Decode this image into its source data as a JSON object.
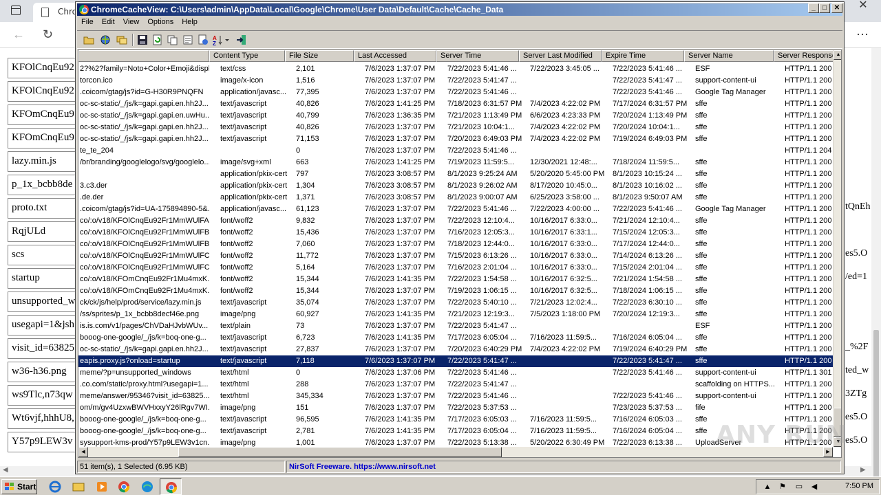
{
  "background": {
    "tab_title": "Chro",
    "left_list": [
      "KFOlCnqEu92",
      "KFOlCnqEu92",
      "KFOmCnqEu9",
      "KFOmCnqEu9",
      "lazy.min.js",
      "p_1x_bcbb8de",
      "proto.txt",
      "RqjULd",
      "scs",
      "startup",
      "unsupported_w",
      "usegapi=1&jsh",
      "visit_id=63825",
      "w36-h36.png",
      "ws9Tlc,n73qw",
      "Wt6vjf,hhhU8,",
      "Y57p9LEW3v"
    ],
    "right_list": [
      "tQnEh",
      "",
      "es5.O",
      "/ed=1",
      "",
      "",
      "_%2F",
      "ted_w",
      "3ZTg",
      "es5.O",
      "es5.O"
    ]
  },
  "app": {
    "title": "ChromeCacheView:  C:\\Users\\admin\\AppData\\Local\\Google\\Chrome\\User Data\\Default\\Cache\\Cache_Data",
    "menu": [
      "File",
      "Edit",
      "View",
      "Options",
      "Help"
    ],
    "columns": [
      "",
      "Content Type",
      "File Size",
      "Last Accessed",
      "Server Time",
      "Server Last Modified",
      "Expire Time",
      "Server Name",
      "Server Response"
    ],
    "rows": [
      [
        "2?%2?family=Noto+Color+Emoji&displ...",
        "text/css",
        "2,101",
        "7/6/2023 1:37:07 PM",
        "7/22/2023 5:41:46 ...",
        "7/22/2023 3:45:05 ...",
        "7/22/2023 5:41:46 ...",
        "ESF",
        "HTTP/1.1 200"
      ],
      [
        "torcon.ico",
        "image/x-icon",
        "1,516",
        "7/6/2023 1:37:07 PM",
        "7/22/2023 5:41:47 ...",
        "",
        "7/22/2023 5:41:47 ...",
        "support-content-ui",
        "HTTP/1.1 200"
      ],
      [
        ".coicom/gtag/js?id=G-H30R9PNQFN",
        "application/javasc...",
        "77,395",
        "7/6/2023 1:37:07 PM",
        "7/22/2023 5:41:46 ...",
        "",
        "7/22/2023 5:41:46 ...",
        "Google Tag Manager",
        "HTTP/1.1 200"
      ],
      [
        "oc-sc-static/_/js/k=gapi.gapi.en.hh2J...",
        "text/javascript",
        "40,826",
        "7/6/2023 1:41:25 PM",
        "7/18/2023 6:31:57 PM",
        "7/4/2023 4:22:02 PM",
        "7/17/2024 6:31:57 PM",
        "sffe",
        "HTTP/1.1 200"
      ],
      [
        "oc-sc-static/_/js/k=gapi.gapi.en.uwHu...",
        "text/javascript",
        "40,799",
        "7/6/2023 1:36:35 PM",
        "7/21/2023 1:13:49 PM",
        "6/6/2023 4:23:33 PM",
        "7/20/2024 1:13:49 PM",
        "sffe",
        "HTTP/1.1 200"
      ],
      [
        "oc-sc-static/_/js/k=gapi.gapi.en.hh2J...",
        "text/javascript",
        "40,826",
        "7/6/2023 1:37:07 PM",
        "7/21/2023 10:04:1...",
        "7/4/2023 4:22:02 PM",
        "7/20/2024 10:04:1...",
        "sffe",
        "HTTP/1.1 200"
      ],
      [
        "oc-sc-static/_/js/k=gapi.gapi.en.hh2J...",
        "text/javascript",
        "71,153",
        "7/6/2023 1:37:07 PM",
        "7/20/2023 6:49:03 PM",
        "7/4/2023 4:22:02 PM",
        "7/19/2024 6:49:03 PM",
        "sffe",
        "HTTP/1.1 200"
      ],
      [
        "te_te_204",
        "",
        "0",
        "7/6/2023 1:37:07 PM",
        "7/22/2023 5:41:46 ...",
        "",
        "",
        "",
        "HTTP/1.1 204"
      ],
      [
        "/br/branding/googlelogo/svg/googlelo...",
        "image/svg+xml",
        "663",
        "7/6/2023 1:41:25 PM",
        "7/19/2023 11:59:5...",
        "12/30/2021 12:48:...",
        "7/18/2024 11:59:5...",
        "sffe",
        "HTTP/1.1 200"
      ],
      [
        "",
        "application/pkix-cert",
        "797",
        "7/6/2023 3:08:57 PM",
        "8/1/2023 9:25:24 AM",
        "5/20/2020 5:45:00 PM",
        "8/1/2023 10:15:24 ...",
        "sffe",
        "HTTP/1.1 200"
      ],
      [
        "3.c3.der",
        "application/pkix-cert",
        "1,304",
        "7/6/2023 3:08:57 PM",
        "8/1/2023 9:26:02 AM",
        "8/17/2020 10:45:0...",
        "8/1/2023 10:16:02 ...",
        "sffe",
        "HTTP/1.1 200"
      ],
      [
        ".de.der",
        "application/pkix-cert",
        "1,371",
        "7/6/2023 3:08:57 PM",
        "8/1/2023 9:00:07 AM",
        "6/25/2023 3:58:00 ...",
        "8/1/2023 9:50:07 AM",
        "sffe",
        "HTTP/1.1 200"
      ],
      [
        ".coicom/gtag/js?id=UA-175894890-5&...",
        "application/javasc...",
        "61,123",
        "7/6/2023 1:37:07 PM",
        "7/22/2023 5:41:46 ...",
        "7/22/2023 4:00:00 ...",
        "7/22/2023 5:41:46 ...",
        "Google Tag Manager",
        "HTTP/1.1 200"
      ],
      [
        "co/:o/v18/KFOlCnqEu92Fr1MmWUlFAB...",
        "font/woff2",
        "9,832",
        "7/6/2023 1:37:07 PM",
        "7/22/2023 12:10:4...",
        "10/16/2017 6:33:0...",
        "7/21/2024 12:10:4...",
        "sffe",
        "HTTP/1.1 200"
      ],
      [
        "co/:o/v18/KFOlCnqEu92Fr1MmWUlFBB...",
        "font/woff2",
        "15,436",
        "7/6/2023 1:37:07 PM",
        "7/16/2023 12:05:3...",
        "10/16/2017 6:33:1...",
        "7/15/2024 12:05:3...",
        "sffe",
        "HTTP/1.1 200"
      ],
      [
        "co/:o/v18/KFOlCnqEu92Fr1MmWUlFBx...",
        "font/woff2",
        "7,060",
        "7/6/2023 1:37:07 PM",
        "7/18/2023 12:44:0...",
        "10/16/2017 6:33:0...",
        "7/17/2024 12:44:0...",
        "sffe",
        "HTTP/1.1 200"
      ],
      [
        "co/:o/v18/KFOlCnqEu92Fr1MmWUlFCh...",
        "font/woff2",
        "11,772",
        "7/6/2023 1:37:07 PM",
        "7/15/2023 6:13:26 ...",
        "10/16/2017 6:33:0...",
        "7/14/2024 6:13:26 ...",
        "sffe",
        "HTTP/1.1 200"
      ],
      [
        "co/:o/v18/KFOlCnqEu92Fr1MmWUlFCx...",
        "font/woff2",
        "5,164",
        "7/6/2023 1:37:07 PM",
        "7/16/2023 2:01:04 ...",
        "10/16/2017 6:33:0...",
        "7/15/2024 2:01:04 ...",
        "sffe",
        "HTTP/1.1 200"
      ],
      [
        "co/:o/v18/KFOmCnqEu92Fr1Mu4mxK...",
        "font/woff2",
        "15,344",
        "7/6/2023 1:41:35 PM",
        "7/22/2023 1:54:58 ...",
        "10/16/2017 6:32:5...",
        "7/21/2024 1:54:58 ...",
        "sffe",
        "HTTP/1.1 200"
      ],
      [
        "co/:o/v18/KFOmCnqEu92Fr1Mu4mxK...",
        "font/woff2",
        "15,344",
        "7/6/2023 1:37:07 PM",
        "7/19/2023 1:06:15 ...",
        "10/16/2017 6:32:5...",
        "7/18/2024 1:06:15 ...",
        "sffe",
        "HTTP/1.1 200"
      ],
      [
        "ck/ck/js/help/prod/service/lazy.min.js",
        "text/javascript",
        "35,074",
        "7/6/2023 1:37:07 PM",
        "7/22/2023 5:40:10 ...",
        "7/21/2023 12:02:4...",
        "7/22/2023 6:30:10 ...",
        "sffe",
        "HTTP/1.1 200"
      ],
      [
        "/ss/sprites/p_1x_bcbb8decf46e.png",
        "image/png",
        "60,927",
        "7/6/2023 1:41:35 PM",
        "7/21/2023 12:19:3...",
        "7/5/2023 1:18:00 PM",
        "7/20/2024 12:19:3...",
        "sffe",
        "HTTP/1.1 200"
      ],
      [
        "is.is.com/v1/pages/ChVDaHJvbWUv...",
        "text/plain",
        "73",
        "7/6/2023 1:37:07 PM",
        "7/22/2023 5:41:47 ...",
        "",
        "",
        "ESF",
        "HTTP/1.1 200"
      ],
      [
        "booog-one-google/_/js/k=boq-one-g...",
        "text/javascript",
        "6,723",
        "7/6/2023 1:41:35 PM",
        "7/17/2023 6:05:04 ...",
        "7/16/2023 11:59:5...",
        "7/16/2024 6:05:04 ...",
        "sffe",
        "HTTP/1.1 200"
      ],
      [
        "oc-sc-static/_/js/k=gapi.gapi.en.hh2J...",
        "text/javascript",
        "27,837",
        "7/6/2023 1:37:07 PM",
        "7/20/2023 6:40:29 PM",
        "7/4/2023 4:22:02 PM",
        "7/19/2024 6:40:29 PM",
        "sffe",
        "HTTP/1.1 200"
      ],
      [
        "eapis.proxy.js?onload=startup",
        "text/javascript",
        "7,118",
        "7/6/2023 1:37:07 PM",
        "7/22/2023 5:41:47 ...",
        "",
        "7/22/2023 5:41:47 ...",
        "sffe",
        "HTTP/1.1 200"
      ],
      [
        "meme/?p=unsupported_windows",
        "text/html",
        "0",
        "7/6/2023 1:37:06 PM",
        "7/22/2023 5:41:46 ...",
        "",
        "7/22/2023 5:41:46 ...",
        "support-content-ui",
        "HTTP/1.1 301"
      ],
      [
        ".co.com/static/proxy.html?usegapi=1...",
        "text/html",
        "288",
        "7/6/2023 1:37:07 PM",
        "7/22/2023 5:41:47 ...",
        "",
        "",
        "scaffolding on HTTPS...",
        "HTTP/1.1 200"
      ],
      [
        "meme/answer/95346?visit_id=63825...",
        "text/html",
        "345,334",
        "7/6/2023 1:37:07 PM",
        "7/22/2023 5:41:46 ...",
        "",
        "7/22/2023 5:41:46 ...",
        "support-content-ui",
        "HTTP/1.1 200"
      ],
      [
        "om/m/gv4UzxwBWVHxxyY26lRgv7WI...",
        "image/png",
        "151",
        "7/6/2023 1:37:07 PM",
        "7/22/2023 5:37:53 ...",
        "",
        "7/23/2023 5:37:53 ...",
        "fife",
        "HTTP/1.1 200"
      ],
      [
        "booog-one-google/_/js/k=boq-one-g...",
        "text/javascript",
        "96,595",
        "7/6/2023 1:41:35 PM",
        "7/17/2023 6:05:03 ...",
        "7/16/2023 11:59:5...",
        "7/16/2024 6:05:03 ...",
        "sffe",
        "HTTP/1.1 200"
      ],
      [
        "booog-one-google/_/js/k=boq-one-g...",
        "text/javascript",
        "2,781",
        "7/6/2023 1:41:35 PM",
        "7/17/2023 6:05:04 ...",
        "7/16/2023 11:59:5...",
        "7/16/2024 6:05:04 ...",
        "sffe",
        "HTTP/1.1 200"
      ],
      [
        "sysupport-kms-prod/Y57p9LEW3v1cn...",
        "image/png",
        "1,001",
        "7/6/2023 1:37:07 PM",
        "7/22/2023 5:13:38 ...",
        "5/20/2022 6:30:49 PM",
        "7/22/2023 6:13:38 ...",
        "UploadServer",
        "HTTP/1.1 200"
      ]
    ],
    "selected_index": 25,
    "status": {
      "count": "51 item(s), 1 Selected  (6.95 KB)",
      "link": "NirSoft Freeware. https://www.nirsoft.net"
    }
  },
  "taskbar": {
    "start_label": "Start",
    "clock": "7:50 PM"
  },
  "watermark": "ANY RUN"
}
